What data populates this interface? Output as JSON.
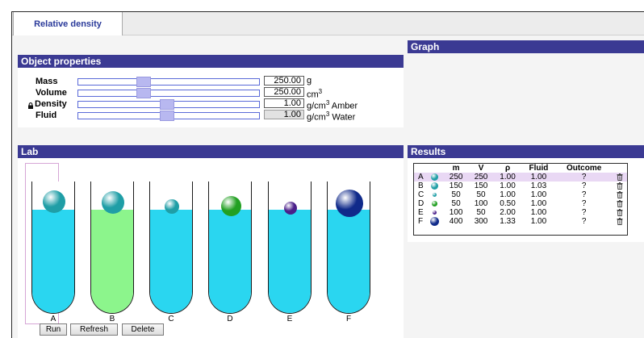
{
  "tabs": [
    {
      "label": "Relative density",
      "active": true
    }
  ],
  "panels": {
    "object_properties": "Object properties",
    "graph": "Graph",
    "lab": "Lab",
    "results": "Results"
  },
  "object_properties": {
    "mass": {
      "label": "Mass",
      "value": "250.00",
      "unit": "g",
      "slider_level": 0.38
    },
    "volume": {
      "label": "Volume",
      "value": "250.00",
      "unit": "cm",
      "unit_sup": "3",
      "slider_level": 0.38
    },
    "density": {
      "label": "Density",
      "value": "1.00",
      "unit": "g/cm",
      "unit_sup": "3",
      "unit_suffix": "Amber",
      "locked": true,
      "slider_level": 0.5
    },
    "fluid": {
      "label": "Fluid",
      "value": "1.00",
      "unit": "g/cm",
      "unit_sup": "3",
      "unit_suffix": "Water",
      "disabled": true,
      "slider_level": 0.5
    }
  },
  "lab": {
    "tubes": [
      {
        "label": "A",
        "fluid_color": "#2ad6f0",
        "ball_color": "#1f9ea6",
        "selected": true
      },
      {
        "label": "B",
        "fluid_color": "#8cf58c",
        "ball_color": "#1f9ea6"
      },
      {
        "label": "C",
        "fluid_color": "#2ad6f0",
        "ball_color": "#1f9ea6"
      },
      {
        "label": "D",
        "fluid_color": "#2ad6f0",
        "ball_color": "#22a022"
      },
      {
        "label": "E",
        "fluid_color": "#2ad6f0",
        "ball_color": "#4a1f8a"
      },
      {
        "label": "F",
        "fluid_color": "#2ad6f0",
        "ball_color": "#102a8a"
      }
    ],
    "buttons": {
      "run": "Run",
      "refresh": "Refresh",
      "delete": "Delete"
    }
  },
  "results": {
    "columns": [
      "",
      "",
      "m",
      "V",
      "ρ",
      "Fluid",
      "Outcome",
      ""
    ],
    "rows": [
      {
        "id": "A",
        "m": "250",
        "v": "250",
        "rho": "1.00",
        "fluid": "1.00",
        "outcome": "?",
        "dot_color": "#1f9ea6",
        "selected": true
      },
      {
        "id": "B",
        "m": "150",
        "v": "150",
        "rho": "1.00",
        "fluid": "1.03",
        "outcome": "?",
        "dot_color": "#1f9ea6"
      },
      {
        "id": "C",
        "m": "50",
        "v": "50",
        "rho": "1.00",
        "fluid": "1.00",
        "outcome": "?",
        "dot_color": "#1f9ea6"
      },
      {
        "id": "D",
        "m": "50",
        "v": "100",
        "rho": "0.50",
        "fluid": "1.00",
        "outcome": "?",
        "dot_color": "#22a022"
      },
      {
        "id": "E",
        "m": "100",
        "v": "50",
        "rho": "2.00",
        "fluid": "1.00",
        "outcome": "?",
        "dot_color": "#4a1f8a"
      },
      {
        "id": "F",
        "m": "400",
        "v": "300",
        "rho": "1.33",
        "fluid": "1.00",
        "outcome": "?",
        "dot_color": "#102a8a"
      }
    ]
  },
  "colors": {
    "panel_header": "#3b3a93",
    "accent_text": "#2a3a9a",
    "selection": "#e9d8f4"
  },
  "icons": {
    "lock": "lock-icon",
    "delete": "trash-icon"
  }
}
